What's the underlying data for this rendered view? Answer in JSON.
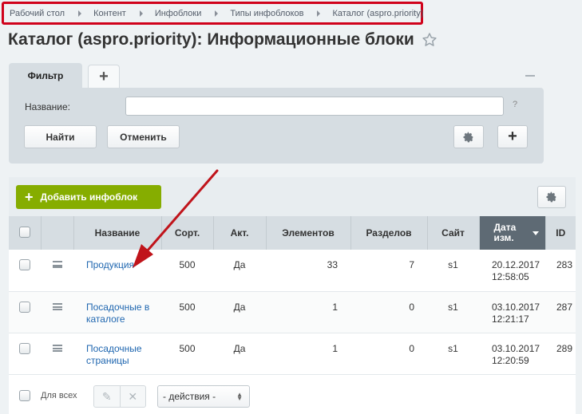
{
  "breadcrumb": {
    "items": [
      "Рабочий стол",
      "Контент",
      "Инфоблоки",
      "Типы инфоблоков",
      "Каталог (aspro.priority)"
    ]
  },
  "page": {
    "title": "Каталог (aspro.priority): Информационные блоки",
    "star_icon": "star-icon"
  },
  "filter": {
    "tab_label": "Фильтр",
    "add_tab": "+",
    "name_label": "Название:",
    "name_value": "",
    "help": "?",
    "find_label": "Найти",
    "cancel_label": "Отменить",
    "plus": "+"
  },
  "toolbar": {
    "add_label": "Добавить инфоблок",
    "add_plus": "+"
  },
  "table": {
    "headers": {
      "name": "Название",
      "sort": "Сорт.",
      "active": "Акт.",
      "elements": "Элементов",
      "sections": "Разделов",
      "site": "Сайт",
      "date": "Дата изм.",
      "id": "ID"
    },
    "rows": [
      {
        "name": "Продукция",
        "sort": "500",
        "active": "Да",
        "elements": "33",
        "sections": "7",
        "site": "s1",
        "date": "20.12.2017 12:58:05",
        "id": "283"
      },
      {
        "name": "Посадочные в каталоге",
        "sort": "500",
        "active": "Да",
        "elements": "1",
        "sections": "0",
        "site": "s1",
        "date": "03.10.2017 12:21:17",
        "id": "287"
      },
      {
        "name": "Посадочные страницы",
        "sort": "500",
        "active": "Да",
        "elements": "1",
        "sections": "0",
        "site": "s1",
        "date": "03.10.2017 12:20:59",
        "id": "289"
      }
    ]
  },
  "footer": {
    "for_all": "Для всех",
    "actions_value": "- действия -"
  },
  "colors": {
    "highlight": "#d0021b",
    "add_button": "#86ad00",
    "link": "#2067b0",
    "sorted_header": "#5e6a74"
  }
}
